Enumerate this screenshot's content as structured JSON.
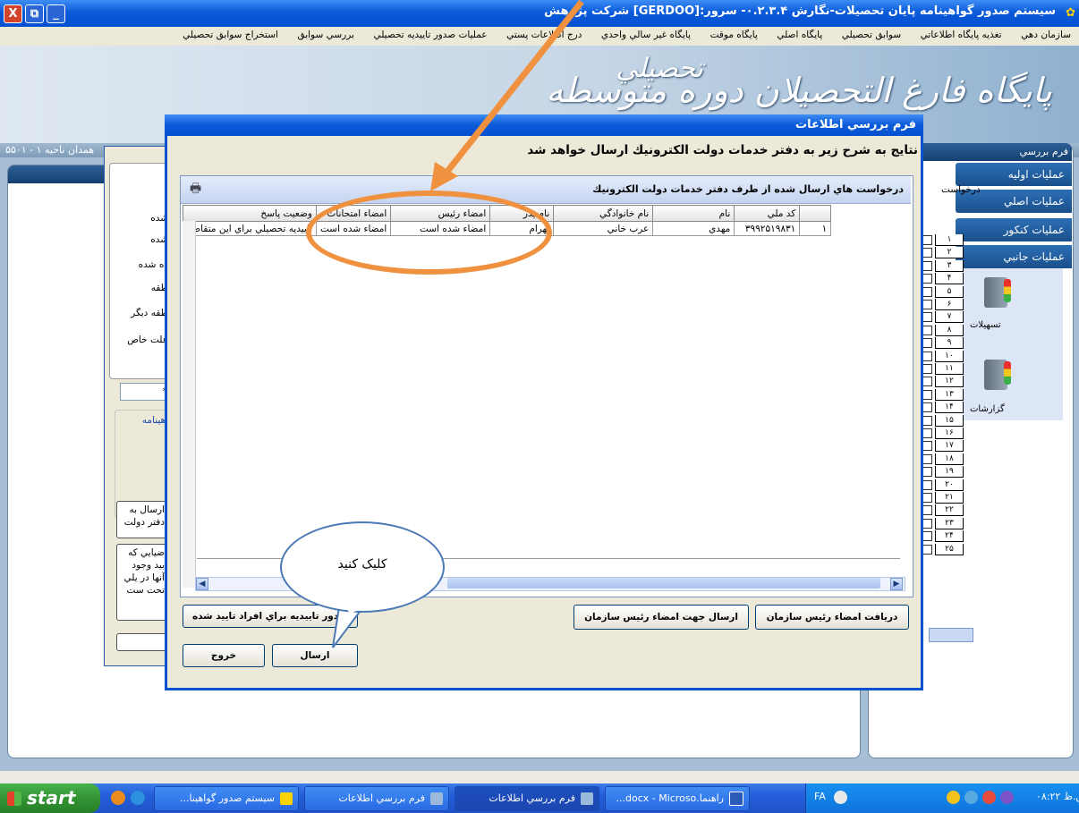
{
  "window": {
    "title": "سيستم صدور گواهينامه پايان تحصيلات-نگارش ۰.۲.۳.۴- سرور:[GERDOO] شرکت پژوهش",
    "controls": {
      "close": "X",
      "restore": "⧉",
      "minimize": "_"
    }
  },
  "menu": {
    "items": [
      "سازمان دهي",
      "تغذيه پايگاه اطلاعاتي",
      "سوابق تحصيلي",
      "پايگاه اصلي",
      "پايگاه موقت",
      "پايگاه غير سالي واحدي",
      "درج اطلاعات پستي",
      "عمليات صدور تاييديه تحصيلي",
      "بررسي سوابق",
      "استخراج سوابق تحصيلي"
    ]
  },
  "banner": {
    "logo_text": "پايگاه فارغ التحصيلان دوره متوسطه",
    "logo_text2": "تحصيلي"
  },
  "location": {
    "text": "همدان  ناحيه ۱  -  ۵۵۰۱"
  },
  "right_panel": {
    "header": "فرم بررسي",
    "buttons": [
      "عمليات اوليه",
      "عمليات اصلي",
      "عمليات كنكور",
      "عمليات جانبي"
    ],
    "request_header": "درخواست",
    "row_numbers": [
      "۱",
      "۲",
      "۳",
      "۴",
      "۵",
      "۶",
      "۷",
      "۸",
      "۹",
      "۱۰",
      "۱۱",
      "۱۲",
      "۱۳",
      "۱۴",
      "۱۵",
      "۱۶",
      "۱۷",
      "۱۸",
      "۱۹",
      "۲۰",
      "۲۱",
      "۲۲",
      "۲۳",
      "۲۴",
      "۲۵"
    ],
    "icon_labels": [
      "تسهيلات",
      "گزارشات"
    ]
  },
  "back_dialog": {
    "labels": [
      "شده",
      "شده",
      "ده شده",
      "طقه",
      "طقه ديگر",
      "علت خاص"
    ],
    "field_value": "*",
    "group_title": "اهينامه",
    "box1": "ارسال به دفتر دولت",
    "box2": "ضيايي كه بيد وجود آنها در يلي تحت ست"
  },
  "dialog": {
    "title": "فرم بررسي اطلاعات",
    "message": "نتايج به شرح زير به دفتر خدمات دولت الكترونيك ارسال خواهد شد",
    "grid_caption": "درخواست هاي ارسال شده از طرف دفتر خدمات دولت الكترونيك",
    "columns": [
      "",
      "كد ملي",
      "نام",
      "نام خانوادگي",
      "نام پدر",
      "امضاء رئيس",
      "امضاء امتحانات",
      "وضعيت پاسخ"
    ],
    "rows": [
      [
        "۱",
        "۳۹۹۲۵۱۹۸۳۱",
        "مهدي",
        "عرب خاني",
        "بهرام",
        "امضاء شده است",
        "امضاء شده است",
        "تاييديه تحصيلي براي اين متقاضي"
      ]
    ],
    "buttons": {
      "receive_signature": "دريافت امضاء رئيس سازمان",
      "send_for_signature": "ارسال جهت امضاء رئيس سازمان",
      "confirm_approved": "صدور تاييديه براي افراد تاييد شده",
      "send": "ارسال",
      "exit": "خروج"
    }
  },
  "callout": {
    "text": "كليک كنيد",
    "color": "#f0913f"
  },
  "taskbar": {
    "start": "start",
    "tasks": [
      "سيستم صدور گواهينا...",
      "فرم بررسي اطلاعات",
      "فرم بررسي اطلاعات",
      "راهنما.docx - Microso..."
    ],
    "lang": "FA",
    "clock": "ق.ظ ۰۸:۲۲"
  }
}
